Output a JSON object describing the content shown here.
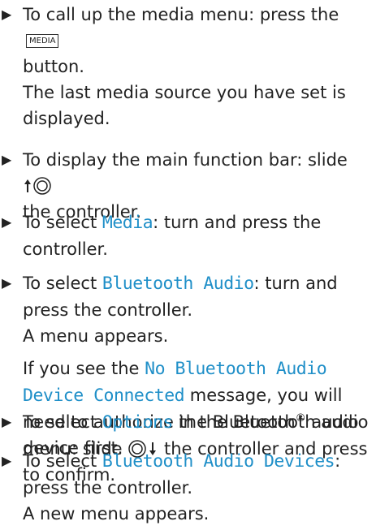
{
  "steps": [
    {
      "p1": "To call up the media menu: press the",
      "key": "MEDIA",
      "p2": "button.",
      "note": "The last media source you have set is displayed."
    },
    {
      "p1": "To display the main function bar: slide",
      "p2": "the controller.",
      "controller_icon": "slide-up-controller-icon"
    },
    {
      "p1": "To select",
      "menu": "Media",
      "p2": ": turn and press the controller."
    },
    {
      "p1": "To select",
      "menu": "Bluetooth Audio",
      "p2": ": turn and press the controller.",
      "note": "A menu appears.",
      "note2_p1": "If you see the",
      "note2_menu": "No Bluetooth Audio Device Connected",
      "note2_p2": "message, you will need to authorize the Bluetooth",
      "note2_reg": "®",
      "note2_p3": "audio device first."
    },
    {
      "p1": "To select",
      "menu": "Options",
      "p2": "in the Bluetooth audio menu: slide",
      "p3": "the controller and press to confirm.",
      "controller_icon": "slide-down-controller-icon"
    },
    {
      "p1": "To select",
      "menu": "Bluetooth Audio Devices",
      "p2": ":",
      "p3": "press the controller.",
      "note": "A new menu appears."
    }
  ],
  "bullet": "▶"
}
